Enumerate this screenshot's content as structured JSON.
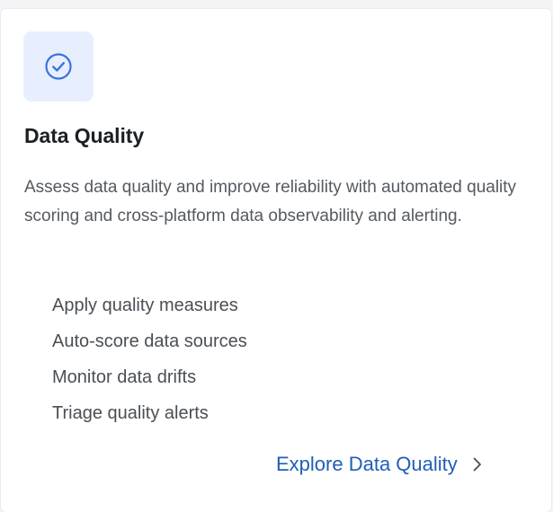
{
  "card": {
    "icon": "check-circle-icon",
    "title": "Data Quality",
    "description": "Assess data quality and improve reliability with automated quality scoring and cross-platform data observability and alerting.",
    "features": [
      "Apply quality measures",
      "Auto-score data sources",
      "Monitor data drifts",
      "Triage quality alerts"
    ],
    "cta": {
      "label": "Explore Data Quality",
      "icon": "chevron-right-icon"
    }
  },
  "colors": {
    "accent": "#1f5fb5",
    "icon_tile_bg": "#e7efff",
    "icon_stroke": "#3b72e0"
  }
}
